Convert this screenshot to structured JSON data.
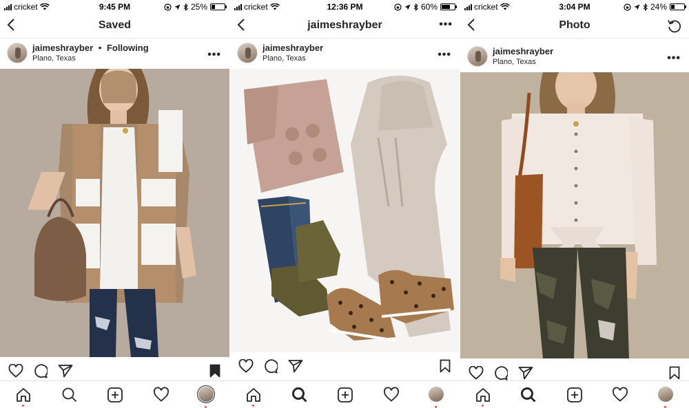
{
  "screens": [
    {
      "status": {
        "carrier": "cricket",
        "time": "9:45 PM",
        "battery": "25%",
        "battery_level": 0.25
      },
      "nav": {
        "title": "Saved"
      },
      "post": {
        "username": "jaimeshrayber",
        "following": "Following",
        "separator": "•",
        "location": "Plano, Texas"
      },
      "bookmark_filled": true
    },
    {
      "status": {
        "carrier": "cricket",
        "time": "12:36 PM",
        "battery": "60%",
        "battery_level": 0.6
      },
      "nav": {
        "title": "jaimeshrayber"
      },
      "post": {
        "username": "jaimeshrayber",
        "location": "Plano, Texas"
      },
      "bookmark_filled": false
    },
    {
      "status": {
        "carrier": "cricket",
        "time": "3:04 PM",
        "battery": "24%",
        "battery_level": 0.24
      },
      "nav": {
        "title": "Photo"
      },
      "post": {
        "username": "jaimeshrayber",
        "location": "Plano, Texas"
      },
      "bookmark_filled": false
    }
  ],
  "icons": {
    "back": "chevron-left-icon",
    "more": "more-horizontal-icon",
    "refresh": "refresh-icon",
    "like": "heart-outline-icon",
    "comment": "comment-icon",
    "share": "paper-plane-icon",
    "save": "bookmark-icon",
    "tab_home": "home-icon",
    "tab_search": "search-icon",
    "tab_add": "add-post-icon",
    "tab_activity": "heart-icon",
    "tab_profile": "profile-avatar"
  },
  "colors": {
    "text": "#262626",
    "notification_dot": "#ed4956",
    "divider": "#dbdbdb"
  }
}
